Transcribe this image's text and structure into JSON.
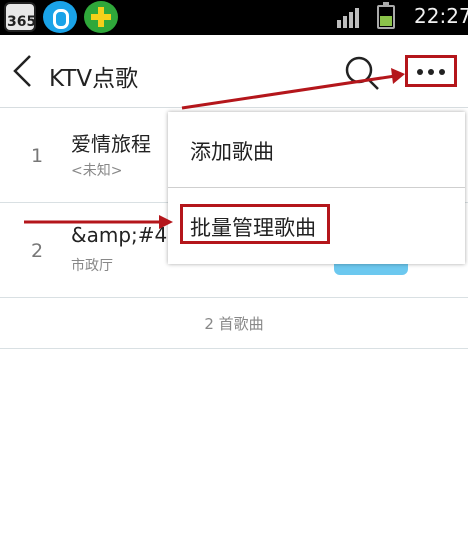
{
  "status_bar": {
    "app_icons": [
      "365-calendar-icon",
      "shield-security-icon",
      "plus-cleaner-icon"
    ],
    "app_icon_365_text": "365",
    "time": "22:27"
  },
  "header": {
    "title": "KTV点歌",
    "back_icon": "chevron-left-icon",
    "search_icon": "search-icon",
    "more_icon": "more-dots-icon"
  },
  "songs": [
    {
      "number": "1",
      "title": "爱情旅程",
      "artist": "<未知>"
    },
    {
      "number": "2",
      "title": "&amp;#4",
      "artist": "市政厅"
    }
  ],
  "song_count_text": "2 首歌曲",
  "popup_menu": {
    "items": [
      "添加歌曲",
      "批量管理歌曲"
    ]
  },
  "colors": {
    "annotation_red": "#b4161b",
    "accent_blue": "#6cc8ef",
    "divider": "#d9e0e3"
  }
}
